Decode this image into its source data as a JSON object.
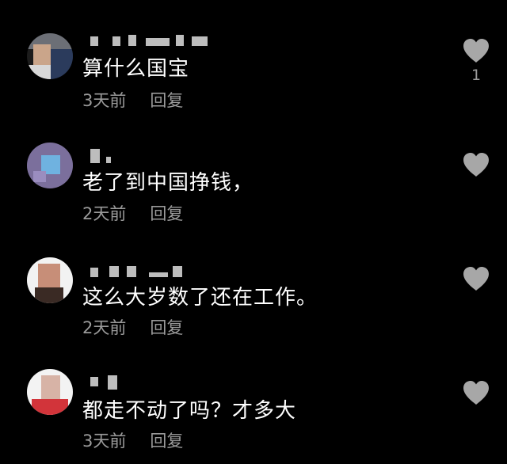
{
  "comments": [
    {
      "text": "算什么国宝",
      "time": "3天前",
      "reply_label": "回复",
      "like_count": "1"
    },
    {
      "text": "老了到中国挣钱，",
      "time": "2天前",
      "reply_label": "回复",
      "like_count": ""
    },
    {
      "text": "这么大岁数了还在工作。",
      "time": "2天前",
      "reply_label": "回复",
      "like_count": ""
    },
    {
      "text": "都走不动了吗？才多大",
      "time": "3天前",
      "reply_label": "回复",
      "like_count": ""
    }
  ],
  "icons": {
    "like": "heart-icon"
  },
  "colors": {
    "background": "#000000",
    "comment_text": "#ffffff",
    "meta_text": "#9a9a9a",
    "heart": "#a7a7a7"
  }
}
